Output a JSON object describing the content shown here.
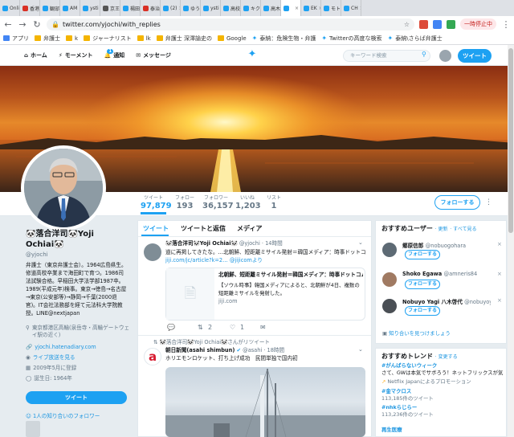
{
  "browser": {
    "tabs": [
      {
        "label": "Onli",
        "color": "#1da1f2"
      },
      {
        "label": "香港",
        "color": "#d93025"
      },
      {
        "label": "観邸",
        "color": "#1da1f2"
      },
      {
        "label": "AM",
        "color": "#1da1f2"
      },
      {
        "label": "ysti",
        "color": "#1da1f2"
      },
      {
        "label": "京王",
        "color": "#555555"
      },
      {
        "label": "楊田",
        "color": "#1da1f2"
      },
      {
        "label": "泰治",
        "color": "#d93025"
      },
      {
        "label": "(2)",
        "color": "#1da1f2"
      },
      {
        "label": "ゆう",
        "color": "#1da1f2"
      },
      {
        "label": "ysti",
        "color": "#1da1f2"
      },
      {
        "label": "高校",
        "color": "#1da1f2"
      },
      {
        "label": "キク",
        "color": "#1da1f2"
      },
      {
        "label": "高木",
        "color": "#1da1f2"
      },
      {
        "label": "",
        "color": "#1da1f2"
      },
      {
        "label": "EK",
        "color": "#1da1f2"
      },
      {
        "label": "モト",
        "color": "#1da1f2"
      },
      {
        "label": "CH",
        "color": "#1da1f2"
      }
    ],
    "url": "twitter.com/yjochi/with_replies",
    "paused_label": "一時停止中",
    "bookmarks": [
      {
        "label": "アプリ",
        "type": "apps"
      },
      {
        "label": "弁護士",
        "type": "folder"
      },
      {
        "label": "k",
        "type": "folder"
      },
      {
        "label": "ジャーナリスト",
        "type": "folder"
      },
      {
        "label": "lk",
        "type": "folder"
      },
      {
        "label": "弁護士 深澤諭史の",
        "type": "folder"
      },
      {
        "label": "Google",
        "type": "folder"
      },
      {
        "label": "泰納：危険生物・弁護",
        "type": "twitter"
      },
      {
        "label": "Twitterの高度な検索",
        "type": "twitter"
      },
      {
        "label": "泰納\\さらば弁護士",
        "type": "twitter"
      }
    ]
  },
  "twitter_nav": {
    "home": "ホーム",
    "moments": "モーメント",
    "notifications": "通知",
    "notif_count": "1",
    "messages": "メッセージ",
    "search_placeholder": "キーワード検索",
    "tweet_button": "ツイート"
  },
  "stats": [
    {
      "label": "ツイート",
      "value": "97,879"
    },
    {
      "label": "フォロー",
      "value": "193"
    },
    {
      "label": "フォロワー",
      "value": "36,157"
    },
    {
      "label": "いいね",
      "value": "1,203"
    },
    {
      "label": "リスト",
      "value": "1"
    }
  ],
  "follow_button": "フォローする",
  "profile": {
    "name": "🐼落合洋司🐼Yoji Ochiai🐼",
    "handle": "@yjochi",
    "bio": "弁護士（東京弁護士会）。1964広島県生。修道高校卒業まで海田町で育つ。1986司法試験合格。早稲田大学法学部1987卒。1989(平成元年)検事。東京→徳島→名古屋→東京(公安部等)→静岡→千葉(2000退官)。IT会社法務部を経て元法科大学院教授。LINE@nextjapan",
    "location": "東京都港区高輪(泉岳寺・高輪ゲートウェイ駅の近く)",
    "website": "yjochi.hatenadiary.com",
    "periscope": "ライブ放送を見る",
    "joined": "2009年5月に登録",
    "birthday": "誕生日: 1964年",
    "tweet_button": "ツイート",
    "followers_you_know": "1人の知り合いのフォロワー"
  },
  "timeline": {
    "tabs": [
      "ツイート",
      "ツイートと返信",
      "メディア"
    ],
    "tweet1": {
      "name": "🐼落合洋司🐼Yoji Ochiai🐼",
      "handle": "@yjochi",
      "time": "14時間",
      "line1": "道に再掲してきたな。…北朝鮮、短距離ミサイル発射＝韓国メディア：時事ドットコムint",
      "line2_link": "jiji.com/jc/article?k=2…",
      "line2_via": "@jijicomより",
      "card_title": "北朝鮮、短距離ミサイル発射＝韓国メディア：時事ドットコム",
      "card_desc": "【ソウル時事】韓国メディアによると、北朝鮮が4日、複数の短距離ミサイルを発射した。",
      "card_domain": "jiji.com",
      "retweets": "2",
      "likes": "1"
    },
    "tweet2": {
      "rt_note": "🐼落合洋司🐼Yoji Ochiai🐼さんがリツイート",
      "name": "朝日新聞(asahi shimbun)",
      "handle": "@asahi",
      "time": "18時間",
      "text": "ホリエモンロケット、打ち上げ成功　民間単独で国内初"
    }
  },
  "who_to_follow": {
    "title": "おすすめユーザー",
    "refresh": "更新",
    "all": "すべて見る",
    "follow_label": "フォローする",
    "users": [
      {
        "name": "郷原信郎",
        "handle": "@nobuogohara"
      },
      {
        "name": "Shoko Egawa",
        "handle": "@amneris84"
      },
      {
        "name": "Nobuyo Yagi 八木啓代",
        "handle": "@nobuyoyagi"
      }
    ],
    "find_friends": "知り合いを見つけましょう"
  },
  "trends": {
    "title": "おすすめトレンド",
    "change": "変更する",
    "items": [
      {
        "name": "#がんばらないウィーク",
        "desc": "さて、GWは本気でサボろう！ネットフリックスが気プランをお届け!?"
      },
      {
        "name": "",
        "desc": "Netflix Japanによるプロモーション"
      },
      {
        "name": "#金マクロス",
        "desc": "113,185件のツイート"
      },
      {
        "name": "#nhkらじらー",
        "desc": "113,236件のツイート"
      },
      {
        "name": "再生医療",
        "desc": ""
      }
    ]
  },
  "colors": {
    "accent": "#1da1f2",
    "text": "#14171a",
    "muted": "#657786"
  }
}
